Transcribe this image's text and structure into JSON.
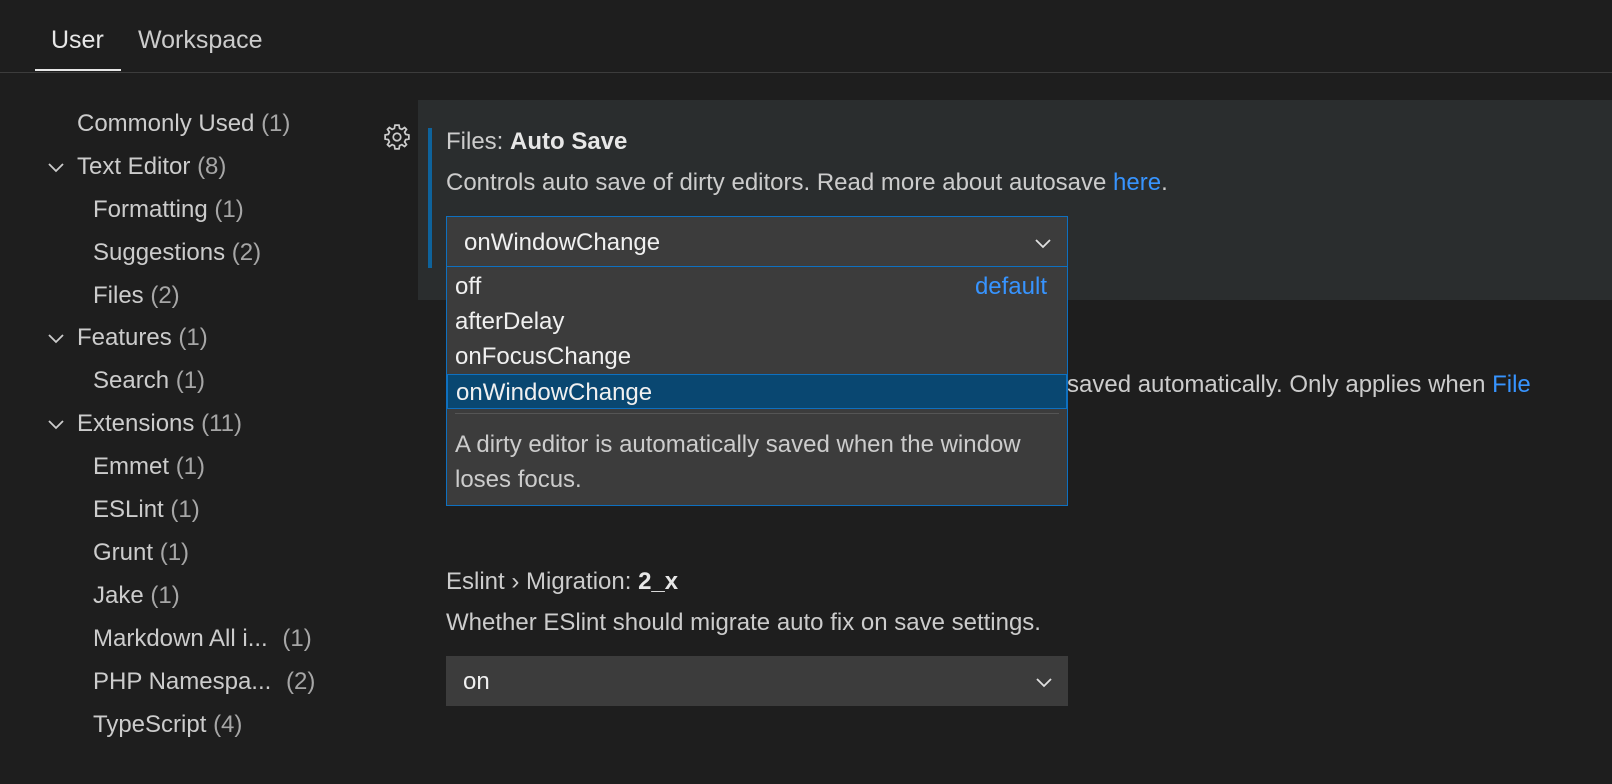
{
  "tabs": {
    "user": "User",
    "workspace": "Workspace"
  },
  "toc": [
    {
      "label": "Commonly Used",
      "count": "(1)"
    },
    {
      "label": "Text Editor",
      "count": "(8)"
    },
    {
      "label": "Formatting",
      "count": "(1)"
    },
    {
      "label": "Suggestions",
      "count": "(2)"
    },
    {
      "label": "Files",
      "count": "(2)"
    },
    {
      "label": "Features",
      "count": "(1)"
    },
    {
      "label": "Search",
      "count": "(1)"
    },
    {
      "label": "Extensions",
      "count": "(11)"
    },
    {
      "label": "Emmet",
      "count": "(1)"
    },
    {
      "label": "ESLint",
      "count": "(1)"
    },
    {
      "label": "Grunt",
      "count": "(1)"
    },
    {
      "label": "Jake",
      "count": "(1)"
    },
    {
      "label": "Markdown All i...",
      "count": "(1)"
    },
    {
      "label": "PHP Namespa...",
      "count": "(2)"
    },
    {
      "label": "TypeScript",
      "count": "(4)"
    }
  ],
  "auto_save": {
    "category": "Files: ",
    "name": "Auto Save",
    "description": "Controls auto save of dirty editors. Read more about autosave ",
    "link": "here",
    "period": ".",
    "value": "onWindowChange",
    "options": [
      {
        "label": "off",
        "badge": "default"
      },
      {
        "label": "afterDelay"
      },
      {
        "label": "onFocusChange"
      },
      {
        "label": "onWindowChange"
      }
    ],
    "option_description": "A dirty editor is automatically saved when the window loses focus."
  },
  "behind_text": {
    "text": "saved automatically. Only applies when ",
    "link": "File"
  },
  "eslint_migration": {
    "category": "Eslint › Migration: ",
    "name": "2_x",
    "description": "Whether ESlint should migrate auto fix on save settings.",
    "value": "on"
  },
  "colors": {
    "background": "#1e1e1e",
    "accent": "#0e70c0",
    "link": "#3794ff",
    "selected_option": "#094771"
  }
}
